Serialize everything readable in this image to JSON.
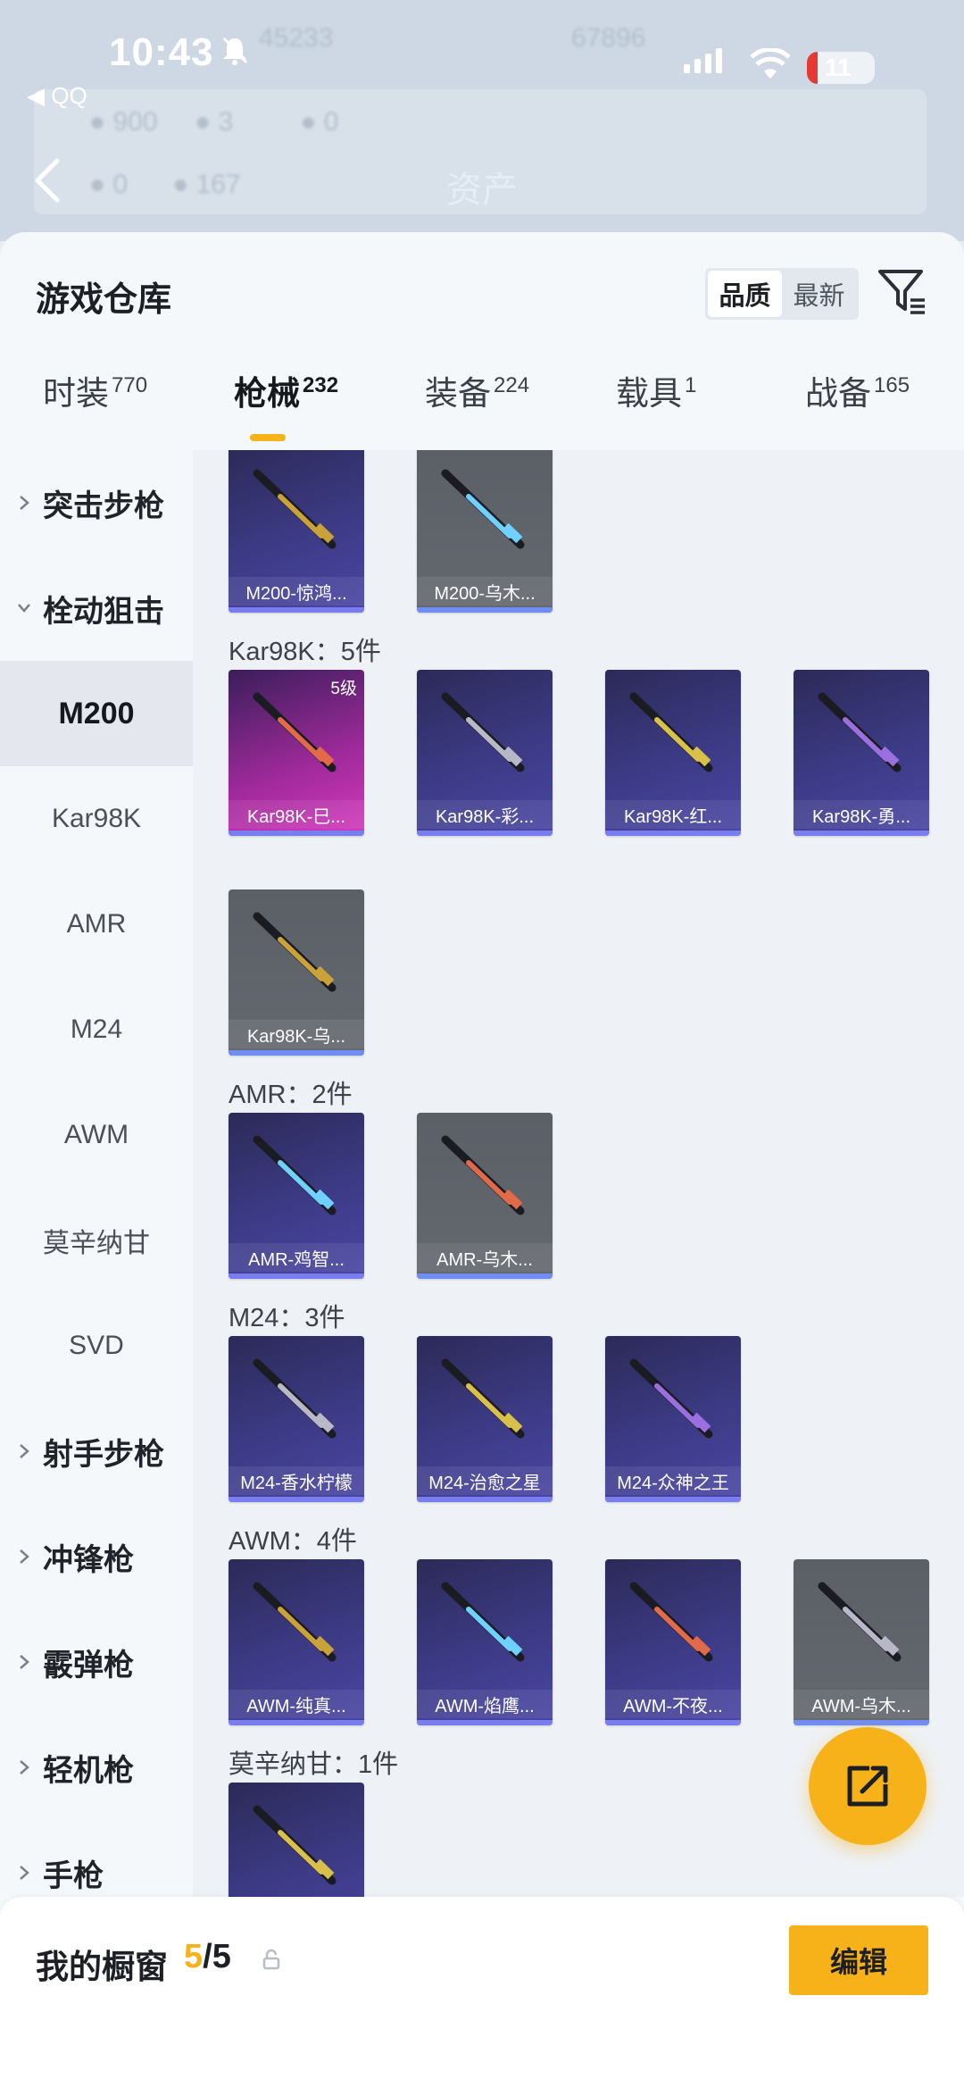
{
  "status_bar": {
    "time": "10:43",
    "back_app": "◀ QQ",
    "battery": "11"
  },
  "background": {
    "asset_label": "资产"
  },
  "header": {
    "title": "游戏仓库",
    "sort_options": [
      "品质",
      "最新"
    ],
    "sort_selected": "品质"
  },
  "tabs": [
    {
      "label": "时装",
      "count": "770"
    },
    {
      "label": "枪械",
      "count": "232"
    },
    {
      "label": "装备",
      "count": "224"
    },
    {
      "label": "载具",
      "count": "1"
    },
    {
      "label": "战备",
      "count": "165"
    }
  ],
  "sidebar": {
    "items": [
      {
        "label": "突击步枪",
        "kind": "category"
      },
      {
        "label": "栓动狙击",
        "kind": "category-open"
      },
      {
        "label": "M200",
        "kind": "selected"
      },
      {
        "label": "Kar98K",
        "kind": "sub"
      },
      {
        "label": "AMR",
        "kind": "sub"
      },
      {
        "label": "M24",
        "kind": "sub"
      },
      {
        "label": "AWM",
        "kind": "sub"
      },
      {
        "label": "莫辛纳甘",
        "kind": "sub"
      },
      {
        "label": "SVD",
        "kind": "sub"
      },
      {
        "label": "射手步枪",
        "kind": "category"
      },
      {
        "label": "冲锋枪",
        "kind": "category"
      },
      {
        "label": "霰弹枪",
        "kind": "category"
      },
      {
        "label": "轻机枪",
        "kind": "category"
      },
      {
        "label": "手枪",
        "kind": "category"
      }
    ]
  },
  "groups": [
    {
      "title": "",
      "items": [
        {
          "name": "M200-惊鸿...",
          "style": "purple"
        },
        {
          "name": "M200-乌木...",
          "style": "gray"
        }
      ]
    },
    {
      "title": "Kar98K：5件",
      "items": [
        {
          "name": "Kar98K-巳...",
          "style": "pink",
          "level": "5级"
        },
        {
          "name": "Kar98K-彩...",
          "style": "purple"
        },
        {
          "name": "Kar98K-红...",
          "style": "purple"
        },
        {
          "name": "Kar98K-勇...",
          "style": "purple"
        },
        {
          "name": "Kar98K-乌...",
          "style": "gray"
        }
      ]
    },
    {
      "title": "AMR：2件",
      "items": [
        {
          "name": "AMR-鸡智...",
          "style": "purple"
        },
        {
          "name": "AMR-乌木...",
          "style": "gray"
        }
      ]
    },
    {
      "title": "M24：3件",
      "items": [
        {
          "name": "M24-香水柠檬",
          "style": "purple"
        },
        {
          "name": "M24-治愈之星",
          "style": "purple"
        },
        {
          "name": "M24-众神之王",
          "style": "purple"
        }
      ]
    },
    {
      "title": "AWM：4件",
      "items": [
        {
          "name": "AWM-纯真...",
          "style": "purple"
        },
        {
          "name": "AWM-焰鹰...",
          "style": "purple"
        },
        {
          "name": "AWM-不夜...",
          "style": "purple"
        },
        {
          "name": "AWM-乌木...",
          "style": "gray"
        }
      ]
    },
    {
      "title": "莫辛纳甘：1件",
      "items": [
        {
          "name": "",
          "style": "purple"
        }
      ]
    }
  ],
  "showcase": {
    "label": "我的橱窗",
    "current": "5",
    "total": "/5",
    "edit_label": "编辑"
  },
  "icons": {
    "filter": "filter-icon",
    "share": "share-icon",
    "lock": "lock-icon",
    "back": "back-arrow-icon"
  },
  "colors": {
    "accent": "#f7b21a",
    "purple_card": "#3d3b86",
    "gray_card": "#5b5f66",
    "pink_card": "#d43bbd"
  }
}
